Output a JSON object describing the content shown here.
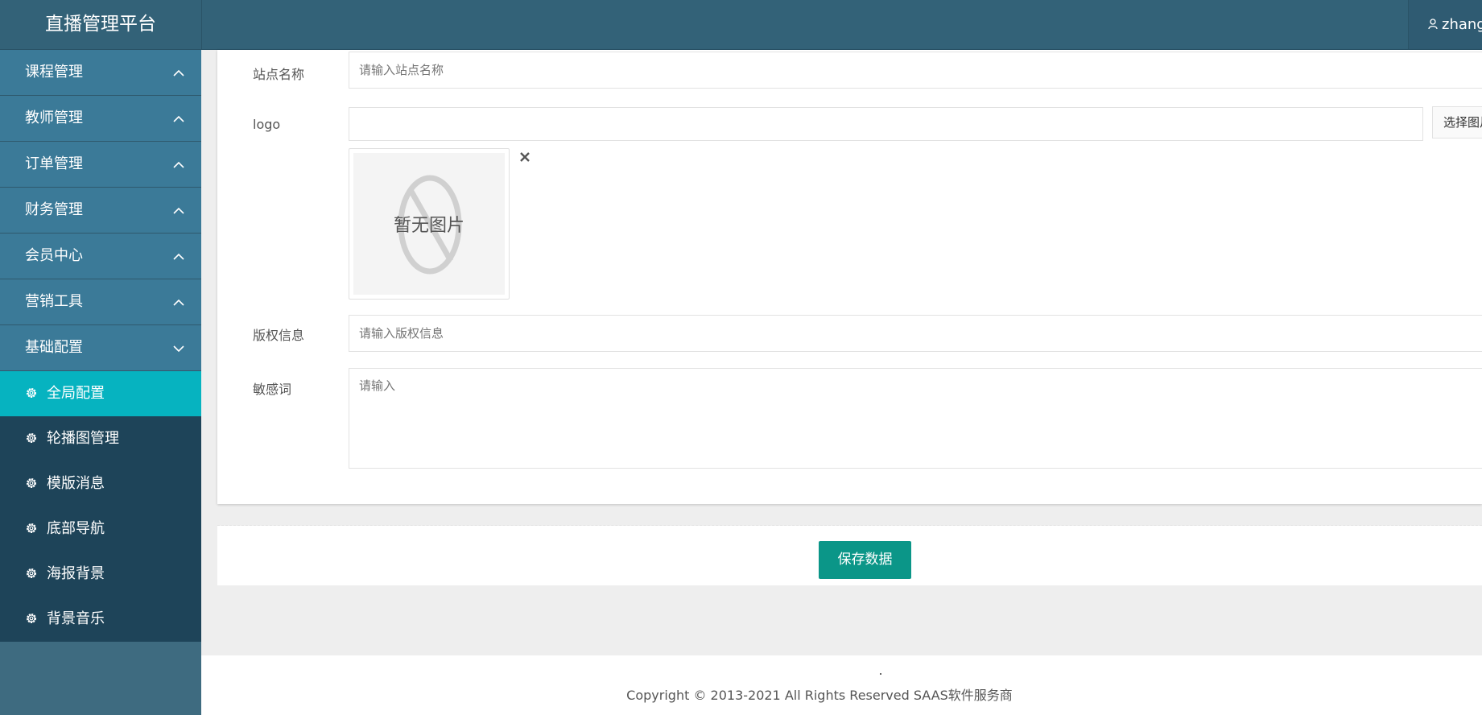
{
  "app": {
    "title": "直播管理平台",
    "user": "zhang"
  },
  "sidebar": {
    "groups": [
      {
        "label": "课程管理"
      },
      {
        "label": "教师管理"
      },
      {
        "label": "订单管理"
      },
      {
        "label": "财务管理"
      },
      {
        "label": "会员中心"
      },
      {
        "label": "营销工具"
      },
      {
        "label": "基础配置"
      }
    ],
    "subitems": [
      {
        "label": "全局配置"
      },
      {
        "label": "轮播图管理"
      },
      {
        "label": "模版消息"
      },
      {
        "label": "底部导航"
      },
      {
        "label": "海报背景"
      },
      {
        "label": "背景音乐"
      }
    ]
  },
  "form": {
    "site_name": {
      "label": "站点名称",
      "placeholder": "请输入站点名称"
    },
    "logo": {
      "label": "logo",
      "value": "",
      "button": "选择图片",
      "preview_text": "暂无图片"
    },
    "copyright_info": {
      "label": "版权信息",
      "placeholder": "请输入版权信息"
    },
    "sensitive": {
      "label": "敏感词",
      "placeholder": "请输入"
    },
    "save_button": "保存数据"
  },
  "footer": {
    "copyright": "Copyright © 2013-2021 All Rights Reserved SAAS软件服务商"
  },
  "colors": {
    "sidebar_group": "#3b7a98",
    "submenu": "#1e4459",
    "active": "#06b3c0",
    "primary_button": "#0b9688"
  }
}
